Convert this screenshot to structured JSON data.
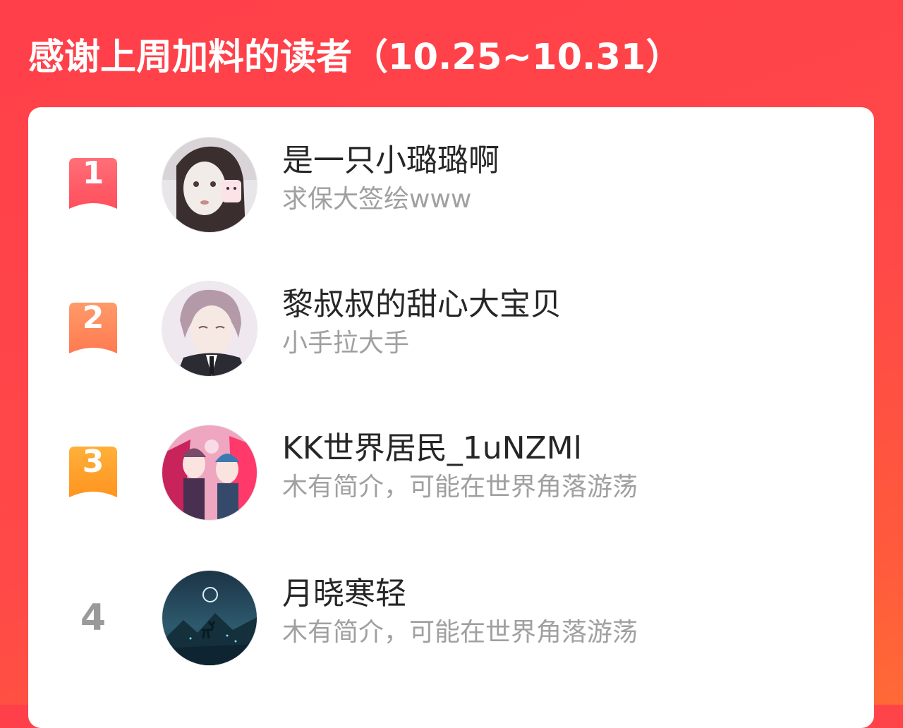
{
  "header": {
    "title": "感谢上周加料的读者（10.25~10.31）"
  },
  "colors": {
    "background_start": "#ff3f4a",
    "background_end": "#ff6a36",
    "rank_1": "#ff5a66",
    "rank_2": "#ff8a5a",
    "rank_3": "#ffa028",
    "rank_plain": "#9a9a9a"
  },
  "readers": [
    {
      "rank": "1",
      "username": "是一只小璐璐啊",
      "bio": "求保大签绘www",
      "avatar_icon": "avatar-girl-face-mask"
    },
    {
      "rank": "2",
      "username": "黎叔叔的甜心大宝贝",
      "bio": "小手拉大手",
      "avatar_icon": "avatar-anime-boy-suit"
    },
    {
      "rank": "3",
      "username": "KK世界居民_1uNZMl",
      "bio": "木有简介，可能在世界角落游荡",
      "avatar_icon": "avatar-anime-characters-colorful"
    },
    {
      "rank": "4",
      "username": "月晓寒轻",
      "bio": "木有简介，可能在世界角落游荡",
      "avatar_icon": "avatar-night-deer-landscape"
    }
  ]
}
